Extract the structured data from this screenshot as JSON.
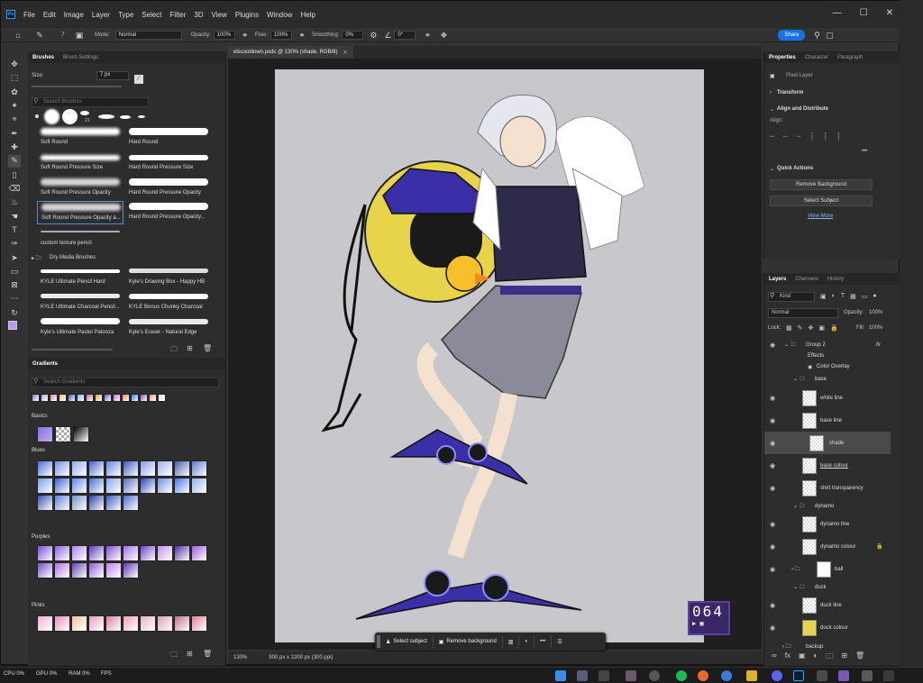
{
  "menubar": {
    "app_icon": "Ps",
    "items": [
      "File",
      "Edit",
      "Image",
      "Layer",
      "Type",
      "Select",
      "Filter",
      "3D",
      "View",
      "Plugins",
      "Window",
      "Help"
    ]
  },
  "options": {
    "mode_label": "Mode:",
    "mode_value": "Normal",
    "opacity_label": "Opacity:",
    "opacity_value": "100%",
    "flow_label": "Flow:",
    "flow_value": "100%",
    "smoothing_label": "Smoothing:",
    "smoothing_value": "0%",
    "angle_value": "0°",
    "brush_size_badge": "7",
    "share_label": "Share"
  },
  "brushes": {
    "tabs": [
      "Brushes",
      "Brush Settings"
    ],
    "size_label": "Size:",
    "size_value": "7 px",
    "search_placeholder": "Search Brushes",
    "recent_size_badge": "21",
    "items": [
      "Soft Round",
      "Hard Round",
      "Soft Round Pressure Size",
      "Hard Round Pressure Size",
      "Soft Round Pressure Opacity",
      "Hard Round Pressure Opacity",
      "Soft Round Pressure Opacity a...",
      "Hard Round Pressure Opacity...",
      "custom texture pencil"
    ],
    "folder": "Dry Media Brushes",
    "dry_items": [
      "KYLE Ultimate Pencil Hard",
      "Kyle's Drawing Box - Happy HB",
      "KYLE Ultimate Charcoal Pencil...",
      "KYLE Bonus Chunky Charcoal",
      "Kyle's Ultimate Pastel Palooza",
      "Kyle's Eraser - Natural Edge"
    ]
  },
  "gradients": {
    "title": "Gradients",
    "search_placeholder": "Search Gradients",
    "folders": [
      "Basics",
      "Blues",
      "Purples",
      "Pinks"
    ],
    "colors": {
      "recent": [
        "#7b7bd6",
        "#b8a0e8",
        "#e88aa8",
        "#e8c070",
        "#4a4ad0",
        "#8ab0f0",
        "#d060a0",
        "#f0a040",
        "#6060e0",
        "#c070e0",
        "#f08060",
        "#3080e0",
        "#9050c0",
        "#e0a070",
        "#e0e0e0"
      ],
      "blues": [
        "#4a6ad8",
        "#7090e8",
        "#90a8f0",
        "#5060c8",
        "#6a80e0",
        "#3858c0",
        "#8898e8",
        "#a0b0f0",
        "#4a58a8",
        "#5a78d0",
        "#7aa0e8",
        "#3a60d0",
        "#6088f0",
        "#4070d0",
        "#8aa8e8",
        "#5a6ab8",
        "#2a48b8",
        "#6a90e0",
        "#4a78e8",
        "#90b0f0",
        "#3850a8",
        "#5a80d8",
        "#7090c8",
        "#2a40a0",
        "#3a58c0",
        "#4a6ad0"
      ],
      "purples": [
        "#7a4ad8",
        "#9060e0",
        "#b080f0",
        "#5a3ac0",
        "#8050d0",
        "#a070e8",
        "#6a40c8",
        "#c090f0",
        "#4a30a8",
        "#9a5ae0",
        "#7050c8",
        "#b070e0",
        "#6040b0",
        "#8a60d8",
        "#c080e8",
        "#5a38b8"
      ],
      "pinks": [
        "#f0b0d0",
        "#e890b8",
        "#f0c0a0",
        "#e8a0c0",
        "#d880a8",
        "#f0a0b0",
        "#e8b0c8",
        "#d8a0b8",
        "#c07090",
        "#e08098"
      ]
    }
  },
  "document": {
    "tab_title": "elscooldown.psdc @ 130% (shade, RGB/8)",
    "zoom": "130%",
    "info": "900 px x 1200 px (300 ppi)"
  },
  "contextbar": {
    "select_subject": "Select subject",
    "remove_background": "Remove background",
    "more": "•••"
  },
  "counter": {
    "value": "064"
  },
  "properties": {
    "tabs": [
      "Properties",
      "Character",
      "Paragraph"
    ],
    "pixel_layer": "Pixel Layer",
    "transform": "Transform",
    "align": "Align and Distribute",
    "align_label": "Align:",
    "quick_actions": "Quick Actions",
    "remove_bg": "Remove Background",
    "select_subject": "Select Subject",
    "view_more": "View More"
  },
  "layers": {
    "tabs": [
      "Layers",
      "Channels",
      "History"
    ],
    "kind": "Kind",
    "blend": "Normal",
    "opacity_label": "Opacity:",
    "opacity_value": "100%",
    "lock_label": "Lock:",
    "fill_label": "Fill:",
    "fill_value": "100%",
    "rows": [
      {
        "name": "Group 2",
        "type": "group"
      },
      {
        "name": "Effects",
        "type": "fx"
      },
      {
        "name": "Color Overlay",
        "type": "fx"
      },
      {
        "name": "base",
        "type": "group"
      },
      {
        "name": "white line",
        "type": "layer"
      },
      {
        "name": "base line",
        "type": "layer"
      },
      {
        "name": "shade",
        "type": "layer"
      },
      {
        "name": "base colour",
        "type": "layer"
      },
      {
        "name": "shirt transparency",
        "type": "layer"
      },
      {
        "name": "dynamo",
        "type": "group"
      },
      {
        "name": "dynamo line",
        "type": "layer"
      },
      {
        "name": "dynamo colour",
        "type": "layer"
      },
      {
        "name": "ball",
        "type": "layer"
      },
      {
        "name": "duck",
        "type": "group"
      },
      {
        "name": "duck line",
        "type": "layer"
      },
      {
        "name": "duck colour",
        "type": "layer"
      },
      {
        "name": "backup",
        "type": "group"
      }
    ]
  },
  "taskbar": {
    "cpu": "CPU 0%",
    "gpu": "GPU 0%",
    "ram": "RAM 0%",
    "fps": "FPS"
  }
}
